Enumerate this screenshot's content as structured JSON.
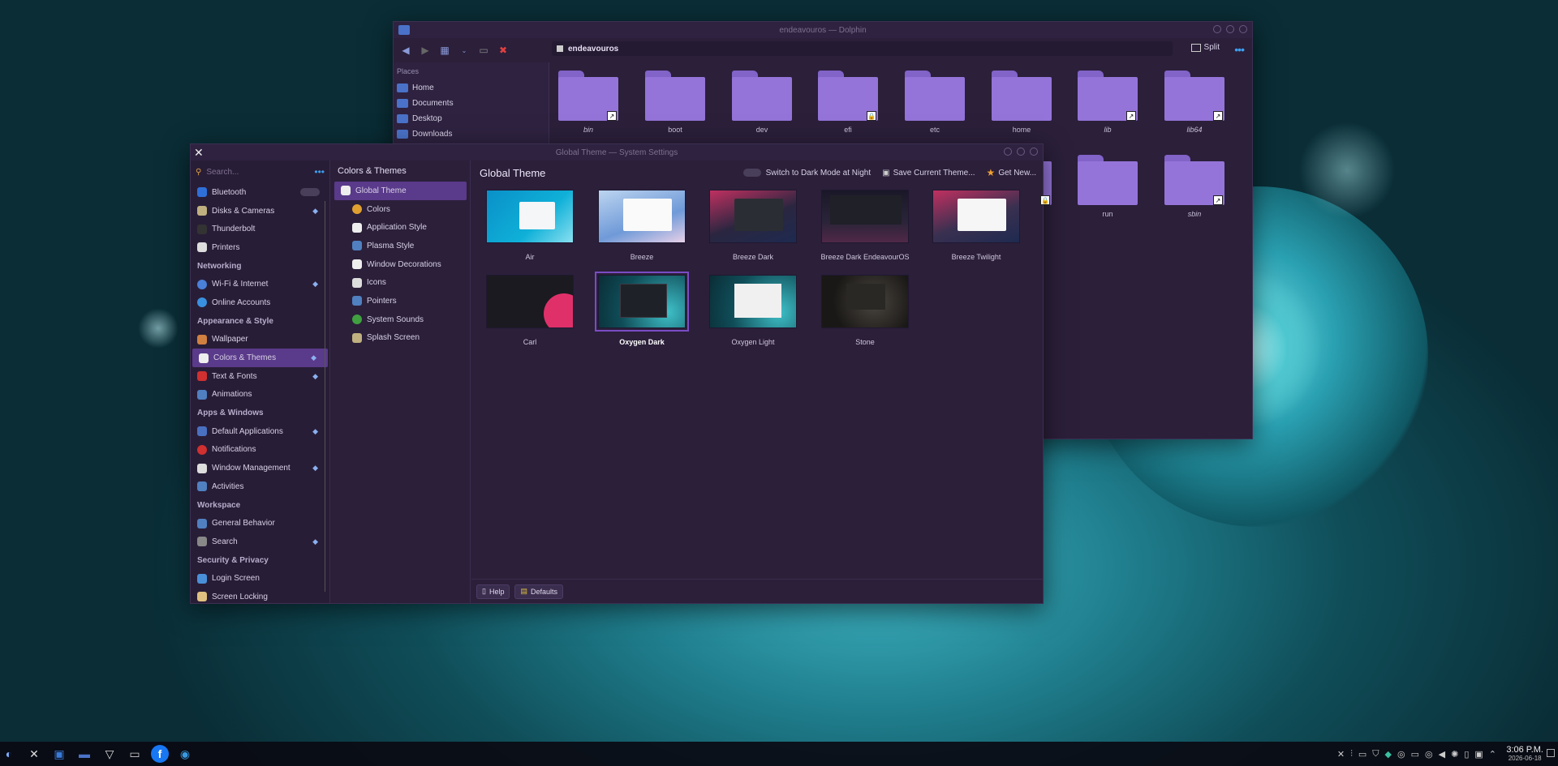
{
  "dolphin": {
    "title": "endeavouros — Dolphin",
    "path": "endeavouros",
    "split_label": "Split",
    "places_header": "Places",
    "places": [
      "Home",
      "Documents",
      "Desktop",
      "Downloads"
    ],
    "folders_row1": [
      "bin",
      "boot",
      "dev",
      "efi",
      "etc",
      "home",
      "lib",
      "lib64"
    ],
    "folders_row2": [
      "run",
      "sbin"
    ]
  },
  "settings": {
    "title": "Global Theme — System Settings",
    "search_placeholder": "Search...",
    "sidebar": {
      "bluetooth": "Bluetooth",
      "disks": "Disks & Cameras",
      "thunderbolt": "Thunderbolt",
      "printers": "Printers",
      "cat_networking": "Networking",
      "wifi": "Wi-Fi & Internet",
      "online": "Online Accounts",
      "cat_appearance": "Appearance & Style",
      "wallpaper": "Wallpaper",
      "colors_themes": "Colors & Themes",
      "text_fonts": "Text & Fonts",
      "animations": "Animations",
      "cat_apps": "Apps & Windows",
      "default_apps": "Default Applications",
      "notifications": "Notifications",
      "window_mgmt": "Window Management",
      "activities": "Activities",
      "cat_workspace": "Workspace",
      "general": "General Behavior",
      "search": "Search",
      "cat_security": "Security & Privacy",
      "login": "Login Screen",
      "locking": "Screen Locking"
    },
    "sub": {
      "header": "Colors & Themes",
      "items": [
        "Global Theme",
        "Colors",
        "Application Style",
        "Plasma Style",
        "Window Decorations",
        "Icons",
        "Pointers",
        "System Sounds",
        "Splash Screen"
      ]
    },
    "main": {
      "title": "Global Theme",
      "dark_toggle": "Switch to Dark Mode at Night",
      "save": "Save Current Theme...",
      "get_new": "Get New...",
      "themes": [
        "Air",
        "Breeze",
        "Breeze Dark",
        "Breeze Dark EndeavourOS",
        "Breeze Twilight",
        "Carl",
        "Oxygen Dark",
        "Oxygen Light",
        "Stone"
      ],
      "selected": "Oxygen Dark",
      "help": "Help",
      "defaults": "Defaults"
    }
  },
  "taskbar": {
    "time": "3:06 P.M.",
    "date": "2026-06-18"
  },
  "colors": {
    "accent": "#5a3a8a",
    "folder": "#9474d8",
    "window_bg": "#2b1f3a"
  }
}
